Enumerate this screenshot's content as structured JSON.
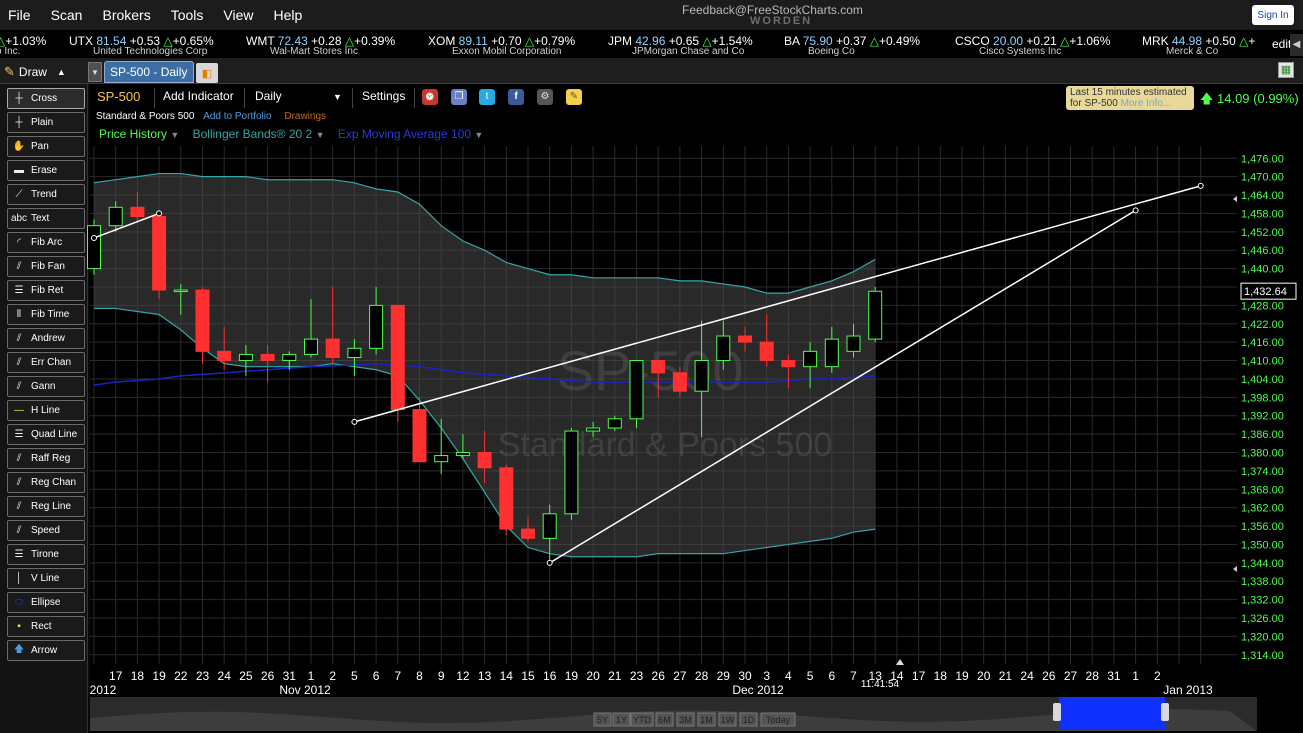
{
  "menu": {
    "items": [
      "File",
      "Scan",
      "Brokers",
      "Tools",
      "View",
      "Help"
    ]
  },
  "header": {
    "feedback": "Feedback@FreeStockCharts.com",
    "brand": "WORDEN",
    "signin_label": "Sign In"
  },
  "ticker": {
    "items": [
      {
        "sym": "",
        "price": "",
        "chg": "",
        "pct": "+1.03%",
        "name": "p Inc."
      },
      {
        "sym": "UTX",
        "price": "81.54",
        "chg": "+0.53",
        "pct": "+0.65%",
        "name": "United Technologies Corp"
      },
      {
        "sym": "WMT",
        "price": "72.43",
        "chg": "+0.28",
        "pct": "+0.39%",
        "name": "Wal-Mart Stores Inc"
      },
      {
        "sym": "XOM",
        "price": "89.11",
        "chg": "+0.70",
        "pct": "+0.79%",
        "name": "Exxon Mobil Corporation"
      },
      {
        "sym": "JPM",
        "price": "42.96",
        "chg": "+0.65",
        "pct": "+1.54%",
        "name": "JPMorgan Chase and Co"
      },
      {
        "sym": "BA",
        "price": "75.90",
        "chg": "+0.37",
        "pct": "+0.49%",
        "name": "Boeing Co"
      },
      {
        "sym": "CSCO",
        "price": "20.00",
        "chg": "+0.21",
        "pct": "+1.06%",
        "name": "Cisco Systems Inc"
      },
      {
        "sym": "MRK",
        "price": "44.98",
        "chg": "+0.50",
        "pct": "+",
        "name": "Merck & Co"
      }
    ],
    "edit_label": "edit"
  },
  "tabs": {
    "draw_label": "Draw",
    "active_tab": "SP-500 - Daily"
  },
  "tools": [
    "Cross",
    "Plain",
    "Pan",
    "Erase",
    "Trend",
    "Text",
    "Fib Arc",
    "Fib Fan",
    "Fib Ret",
    "Fib Time",
    "Andrew",
    "Err Chan",
    "Gann",
    "H Line",
    "Quad Line",
    "Raff Reg",
    "Reg Chan",
    "Reg Line",
    "Speed",
    "Tirone",
    "V Line",
    "Ellipse",
    "Rect",
    "Arrow"
  ],
  "toolbar": {
    "symbol": "SP-500",
    "add_indicator": "Add Indicator",
    "interval": "Daily",
    "settings": "Settings"
  },
  "subheader": {
    "name": "Standard & Poors 500",
    "add_portfolio": "Add to Portfolio",
    "drawings": "Drawings"
  },
  "indicators": {
    "price_history": "Price History",
    "bollinger": "Bollinger Bands® 20 2",
    "ema": "Exp Moving Average 100"
  },
  "estimate": {
    "line1": "Last 15 minutes estimated",
    "line2": "for SP-500",
    "more": "More Info..."
  },
  "change": {
    "text": "14.09 (0.99%)"
  },
  "watermark": {
    "symbol": "SP-500",
    "name": "Standard & Poors 500"
  },
  "colors": {
    "up": "#4cff4c",
    "down": "#ff3030",
    "band": "#36a6a6",
    "ema": "#1a22c8",
    "grid": "#2a2a2a",
    "axis_text": "#4cff4c"
  },
  "chart_data": {
    "type": "candlestick",
    "ylim": [
      1311,
      1480
    ],
    "yticks": [
      "1,476.00",
      "1,470.00",
      "1,464.00",
      "1,458.00",
      "1,452.00",
      "1,446.00",
      "1,440.00",
      "1,434.00",
      "1,428.00",
      "1,422.00",
      "1,416.00",
      "1,410.00",
      "1,404.00",
      "1,398.00",
      "1,392.00",
      "1,386.00",
      "1,380.00",
      "1,374.00",
      "1,368.00",
      "1,362.00",
      "1,356.00",
      "1,350.00",
      "1,344.00",
      "1,338.00",
      "1,332.00",
      "1,326.00",
      "1,320.00",
      "1,314.00"
    ],
    "last_price": "1,432.64",
    "dates": [
      "16",
      "17",
      "18",
      "19",
      "22",
      "23",
      "24",
      "25",
      "26",
      "31",
      "1",
      "2",
      "5",
      "6",
      "7",
      "8",
      "9",
      "12",
      "13",
      "14",
      "15",
      "16",
      "19",
      "20",
      "21",
      "23",
      "26",
      "27",
      "28",
      "29",
      "30",
      "3",
      "4",
      "5",
      "6",
      "7",
      "10"
    ],
    "xtick_labels": [
      "17",
      "18",
      "19",
      "22",
      "23",
      "24",
      "25",
      "26",
      "31",
      "1",
      "2",
      "5",
      "6",
      "7",
      "8",
      "9",
      "12",
      "13",
      "14",
      "15",
      "16",
      "19",
      "20",
      "21",
      "23",
      "26",
      "27",
      "28",
      "29",
      "30",
      "3",
      "4",
      "5",
      "6",
      "7",
      "13",
      "14",
      "17",
      "18",
      "19",
      "20",
      "21",
      "24",
      "26",
      "27",
      "28",
      "31",
      "1",
      "2"
    ],
    "month_labels": [
      "2012",
      "Nov 2012",
      "Dec 2012",
      "Jan 2013"
    ],
    "time_label": "11:41:54",
    "open": [
      1440.0,
      1454.0,
      1460.0,
      1457.0,
      1433.0,
      1433.0,
      1413.0,
      1410.0,
      1412.0,
      1410.0,
      1412.0,
      1417.0,
      1411.0,
      1414.0,
      1428.0,
      1394.0,
      1377.0,
      1379.0,
      1380.0,
      1375.0,
      1355.0,
      1352.0,
      1360.0,
      1387.0,
      1388.0,
      1391.0,
      1410.0,
      1406.0,
      1400.0,
      1410.0,
      1418.0,
      1416.0,
      1410.0,
      1408.0,
      1408.0,
      1413.0,
      1417.0,
      1418.0
    ],
    "close": [
      1454.0,
      1460.0,
      1457.0,
      1433.0,
      1433.0,
      1413.0,
      1410.0,
      1412.0,
      1410.0,
      1412.0,
      1417.0,
      1411.0,
      1414.0,
      1428.0,
      1394.0,
      1377.0,
      1379.0,
      1380.0,
      1375.0,
      1355.0,
      1352.0,
      1360.0,
      1387.0,
      1388.0,
      1391.0,
      1410.0,
      1406.0,
      1400.0,
      1410.0,
      1418.0,
      1416.0,
      1410.0,
      1408.0,
      1413.0,
      1417.0,
      1418.0,
      1432.6
    ],
    "high": [
      1456.0,
      1462.0,
      1465.0,
      1458.0,
      1435.0,
      1434.0,
      1421.0,
      1415.0,
      1415.0,
      1413.0,
      1430.0,
      1434.0,
      1417.0,
      1434.0,
      1428.0,
      1398.0,
      1391.0,
      1386.0,
      1387.0,
      1376.0,
      1359.0,
      1363.0,
      1388.0,
      1390.0,
      1392.0,
      1410.0,
      1409.0,
      1408.0,
      1423.0,
      1423.0,
      1421.0,
      1425.0,
      1412.0,
      1416.0,
      1421.0,
      1422.0,
      1434.0
    ],
    "low": [
      1438.0,
      1452.0,
      1455.0,
      1430.0,
      1425.0,
      1409.0,
      1407.0,
      1405.0,
      1403.0,
      1407.0,
      1411.0,
      1409.0,
      1405.0,
      1412.0,
      1390.0,
      1377.0,
      1373.0,
      1378.0,
      1370.0,
      1353.0,
      1351.0,
      1344.0,
      1358.0,
      1385.0,
      1387.0,
      1388.0,
      1398.0,
      1398.0,
      1385.0,
      1407.0,
      1413.0,
      1408.0,
      1401.0,
      1401.0,
      1406.0,
      1411.0,
      1416.0
    ],
    "bb_upper": [
      1468.0,
      1469.0,
      1470.0,
      1471.0,
      1471.0,
      1470.0,
      1470.0,
      1470.0,
      1469.0,
      1469.0,
      1469.0,
      1469.0,
      1468.0,
      1466.0,
      1465.0,
      1461.0,
      1454.0,
      1449.0,
      1446.0,
      1442.0,
      1440.0,
      1438.0,
      1438.0,
      1437.0,
      1437.0,
      1437.0,
      1437.0,
      1436.0,
      1436.0,
      1435.0,
      1434.0,
      1432.0,
      1432.0,
      1434.0,
      1436.0,
      1439.0,
      1443.0
    ],
    "bb_lower": [
      1427.0,
      1427.0,
      1426.0,
      1425.0,
      1420.0,
      1414.0,
      1409.0,
      1408.0,
      1408.0,
      1408.0,
      1408.0,
      1409.0,
      1408.0,
      1407.0,
      1405.0,
      1397.0,
      1388.0,
      1378.0,
      1367.0,
      1356.0,
      1349.0,
      1347.0,
      1346.0,
      1346.0,
      1346.0,
      1346.0,
      1347.0,
      1347.0,
      1347.0,
      1347.0,
      1348.0,
      1349.0,
      1350.0,
      1351.0,
      1352.0,
      1354.0,
      1355.0
    ],
    "ema100": [
      1402.0,
      1403.0,
      1403.5,
      1404.0,
      1405.0,
      1405.5,
      1406.0,
      1406.5,
      1407.0,
      1407.5,
      1408.0,
      1408.3,
      1408.5,
      1409.0,
      1408.5,
      1408.0,
      1407.0,
      1406.0,
      1405.5,
      1405.0,
      1404.5,
      1404.0,
      1403.5,
      1403.0,
      1403.0,
      1403.0,
      1403.0,
      1403.0,
      1403.0,
      1403.0,
      1403.0,
      1403.0,
      1403.5,
      1404.0,
      1404.0,
      1404.5,
      1405.0
    ],
    "trendlines": [
      {
        "from": [
          0,
          1450
        ],
        "to": [
          3,
          1458
        ]
      },
      {
        "from": [
          12,
          1390
        ],
        "to": [
          51,
          1467
        ]
      },
      {
        "from": [
          21,
          1344
        ],
        "to": [
          48,
          1459
        ]
      }
    ]
  },
  "scrollbar": {
    "ranges": [
      "5Y",
      "1Y",
      "YTD",
      "6M",
      "3M",
      "1M",
      "1W",
      "1D",
      "Today"
    ]
  }
}
